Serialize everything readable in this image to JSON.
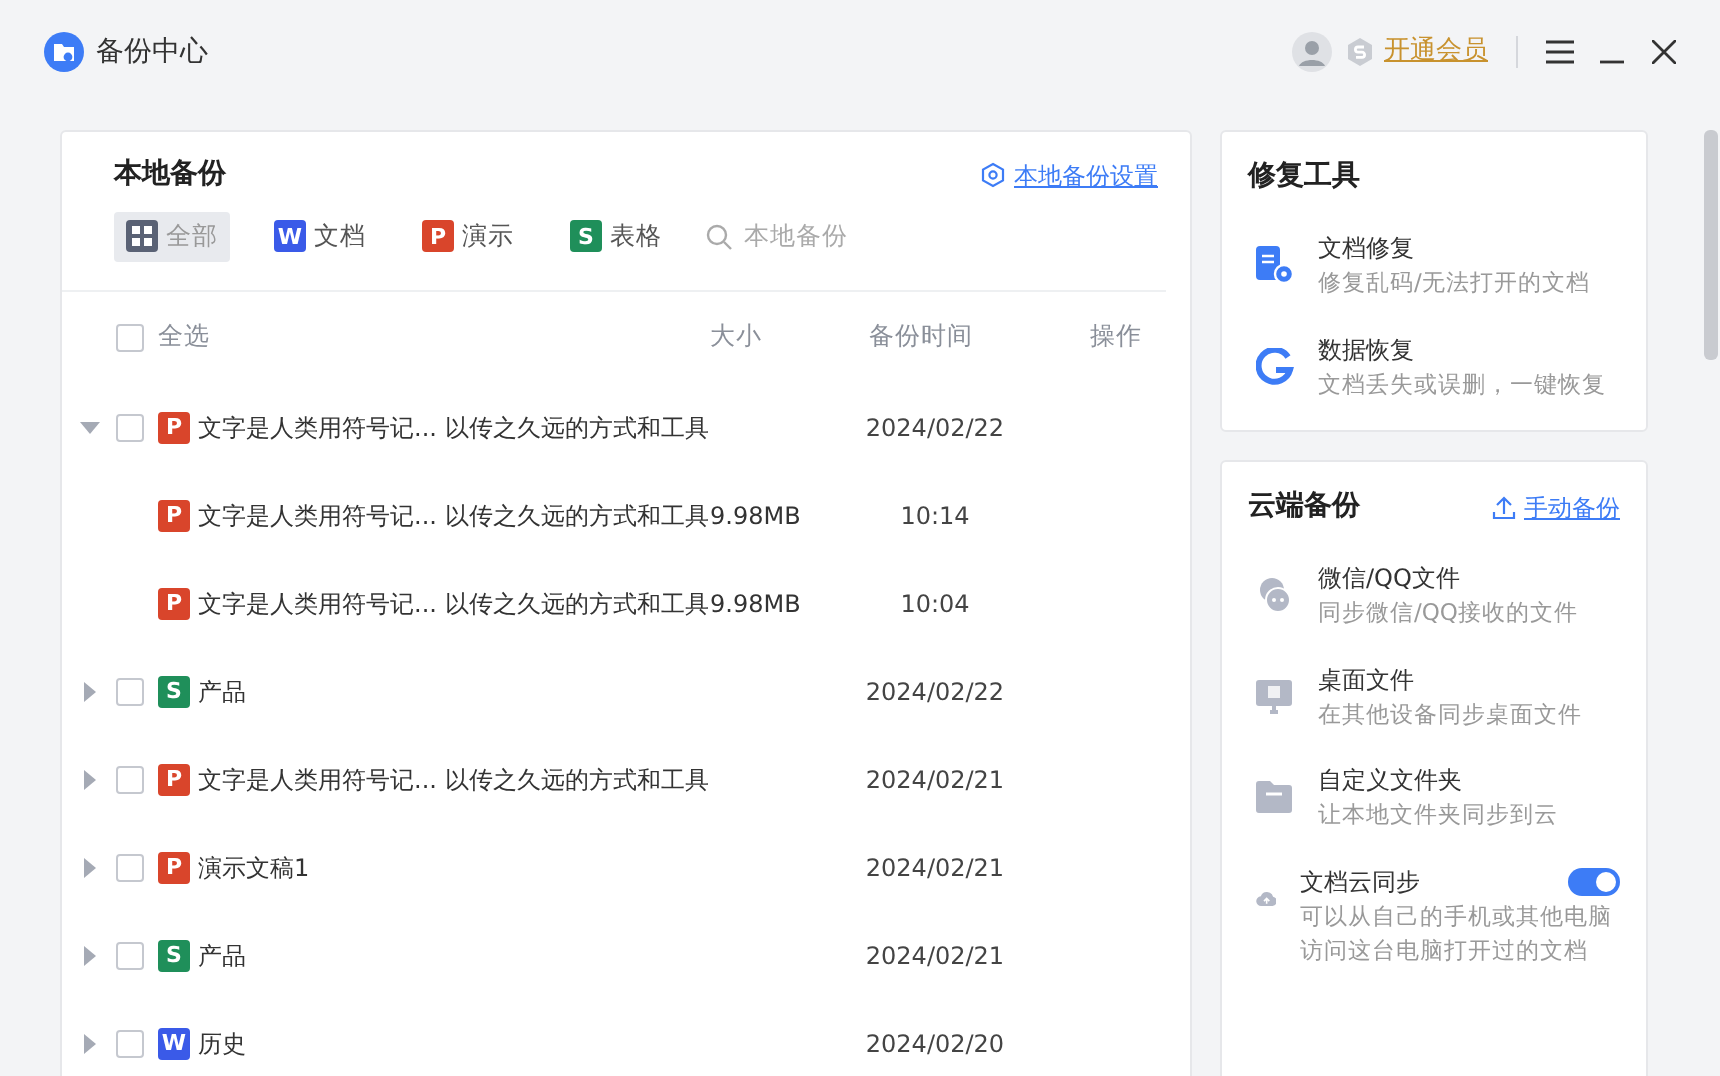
{
  "window": {
    "title": "备份中心",
    "member_link": "开通会员"
  },
  "local_backup": {
    "title": "本地备份",
    "settings_link": "本地备份设置",
    "filters": [
      {
        "label": "全部",
        "selected": true,
        "kind": "all"
      },
      {
        "label": "文档",
        "selected": false,
        "kind": "doc",
        "letter": "W"
      },
      {
        "label": "演示",
        "selected": false,
        "kind": "ppt",
        "letter": "P"
      },
      {
        "label": "表格",
        "selected": false,
        "kind": "sheet",
        "letter": "S"
      }
    ],
    "search": {
      "placeholder": "本地备份"
    },
    "table": {
      "columns": [
        "全选",
        "大小",
        "备份时间",
        "操作"
      ],
      "select_all_checked": false,
      "rows": [
        {
          "kind": "ppt",
          "letter": "P",
          "name": "文字是人类用符号记... 以传之久远的方式和工具",
          "date": "2024/02/22",
          "checked": false,
          "expanded": true,
          "children": [
            {
              "kind": "ppt",
              "letter": "P",
              "name": "文字是人类用符号记... 以传之久远的方式和工具",
              "size": "9.98MB",
              "date": "10:14"
            },
            {
              "kind": "ppt",
              "letter": "P",
              "name": "文字是人类用符号记... 以传之久远的方式和工具",
              "size": "9.98MB",
              "date": "10:04"
            }
          ]
        },
        {
          "kind": "sheet",
          "letter": "S",
          "name": "产品",
          "date": "2024/02/22",
          "checked": false,
          "expanded": false
        },
        {
          "kind": "ppt",
          "letter": "P",
          "name": "文字是人类用符号记... 以传之久远的方式和工具",
          "date": "2024/02/21",
          "checked": false,
          "expanded": false
        },
        {
          "kind": "ppt",
          "letter": "P",
          "name": "演示文稿1",
          "date": "2024/02/21",
          "checked": false,
          "expanded": false
        },
        {
          "kind": "sheet",
          "letter": "S",
          "name": "产品",
          "date": "2024/02/21",
          "checked": false,
          "expanded": false
        },
        {
          "kind": "doc",
          "letter": "W",
          "name": "历史",
          "date": "2024/02/20",
          "checked": false,
          "expanded": false
        }
      ]
    }
  },
  "repair_tools": {
    "title": "修复工具",
    "items": [
      {
        "title": "文档修复",
        "description": "修复乱码/无法打开的文档"
      },
      {
        "title": "数据恢复",
        "description": "文档丢失或误删，一键恢复"
      }
    ]
  },
  "cloud_backup": {
    "title": "云端备份",
    "action": "手动备份",
    "items": [
      {
        "title": "微信/QQ文件",
        "description": "同步微信/QQ接收的文件"
      },
      {
        "title": "桌面文件",
        "description": "在其他设备同步桌面文件"
      },
      {
        "title": "自定义文件夹",
        "description": "让本地文件夹同步到云"
      },
      {
        "title": "文档云同步",
        "description": "可以从自己的手机或其他电脑访问这台电脑打开过的文档",
        "on": true
      }
    ]
  }
}
